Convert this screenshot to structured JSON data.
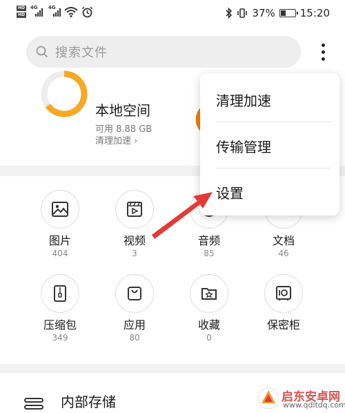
{
  "status_bar": {
    "network_badges": [
      "HD",
      "HD"
    ],
    "signal_labels": [
      "4G",
      "4G"
    ],
    "battery_percent": "37%",
    "battery_level": 0.37,
    "time": "15:20"
  },
  "search": {
    "placeholder": "搜索文件"
  },
  "storage": {
    "title": "本地空间",
    "free": "可用 8.88 GB",
    "clean_link": "清理加速 ›",
    "used_fraction": 0.65,
    "ring_color": "#f7a825"
  },
  "categories": [
    {
      "label": "图片",
      "count": "404",
      "icon": "image-icon"
    },
    {
      "label": "视频",
      "count": "3",
      "icon": "video-icon"
    },
    {
      "label": "音频",
      "count": "85",
      "icon": "audio-icon"
    },
    {
      "label": "文档",
      "count": "46",
      "icon": "document-icon"
    },
    {
      "label": "压缩包",
      "count": "349",
      "icon": "zip-icon"
    },
    {
      "label": "应用",
      "count": "80",
      "icon": "app-bag-icon"
    },
    {
      "label": "收藏",
      "count": "0",
      "icon": "favorite-folder-icon"
    },
    {
      "label": "保密柜",
      "count": "",
      "icon": "safe-icon"
    }
  ],
  "internal_storage": {
    "title": "内部存储"
  },
  "menu": {
    "items": [
      {
        "label": "清理加速"
      },
      {
        "label": "传输管理"
      },
      {
        "label": "设置"
      }
    ]
  },
  "annotation": {
    "arrow_color": "#e53935"
  },
  "watermark": {
    "title": "启东安卓网",
    "url": "www.qdltdq.com",
    "color": "#d9534f"
  }
}
